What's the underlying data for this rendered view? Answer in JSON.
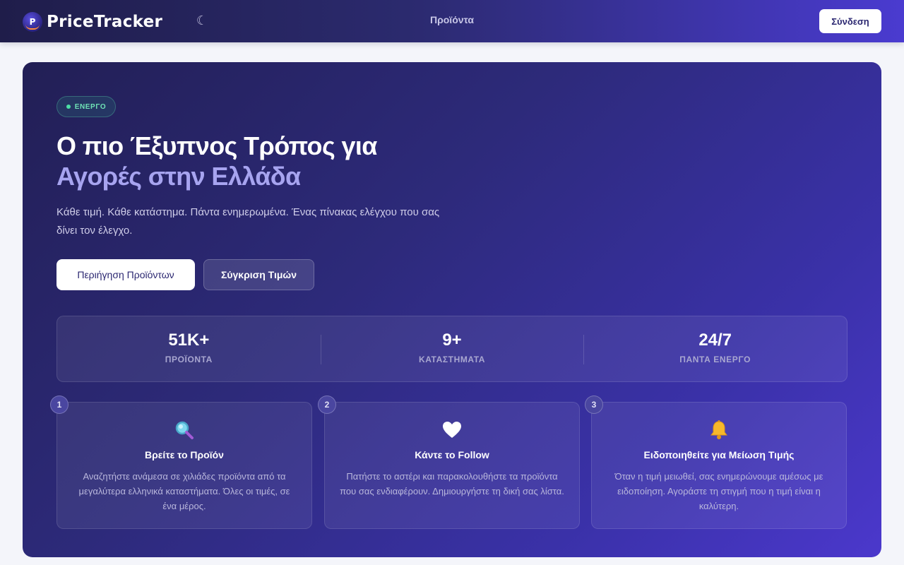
{
  "navbar": {
    "brand_name": "PriceTracker",
    "logo_letter": "P",
    "theme_toggle_glyph": "☾",
    "nav_link": "Προϊόντα",
    "login_label": "Σύνδεση"
  },
  "hero": {
    "badge": "ΕΝΕΡΓΟ",
    "title_line1": "Ο πιο Έξυπνος Τρόπος για",
    "title_line2": "Αγορές στην Ελλάδα",
    "subtitle": "Κάθε τιμή. Κάθε κατάστημα. Πάντα ενημερωμένα. Ένας πίνακας ελέγχου που σας δίνει τον έλεγχο.",
    "primary_button": "Περιήγηση Προϊόντων",
    "secondary_button": "Σύγκριση Τιμών"
  },
  "stats": [
    {
      "value": "51K+",
      "label": "ΠΡΟΪΟΝΤΑ"
    },
    {
      "value": "9+",
      "label": "ΚΑΤΑΣΤΗΜΑΤΑ"
    },
    {
      "value": "24/7",
      "label": "ΠΑΝΤΑ ΕΝΕΡΓΟ"
    }
  ],
  "steps": [
    {
      "number": "1",
      "icon": "magnifier-icon",
      "title": "Βρείτε το Προϊόν",
      "description": "Αναζητήστε ανάμεσα σε χιλιάδες προϊόντα από τα μεγαλύτερα ελληνικά καταστήματα. Όλες οι τιμές, σε ένα μέρος."
    },
    {
      "number": "2",
      "icon": "heart-icon",
      "title": "Κάντε το Follow",
      "description": "Πατήστε το αστέρι και παρακολουθήστε τα προϊόντα που σας ενδιαφέρουν. Δημιουργήστε τη δική σας λίστα."
    },
    {
      "number": "3",
      "icon": "bell-icon",
      "title": "Ειδοποιηθείτε για Μείωση Τιμής",
      "description": "Όταν η τιμή μειωθεί, σας ενημερώνουμε αμέσως με ειδοποίηση. Αγοράστε τη στιγμή που η τιμή είναι η καλύτερη."
    }
  ],
  "colors": {
    "accent_light": "#a7a4f0",
    "active_green": "#4be0a5",
    "hero_start": "#221f55",
    "hero_end": "#4b38cc"
  }
}
